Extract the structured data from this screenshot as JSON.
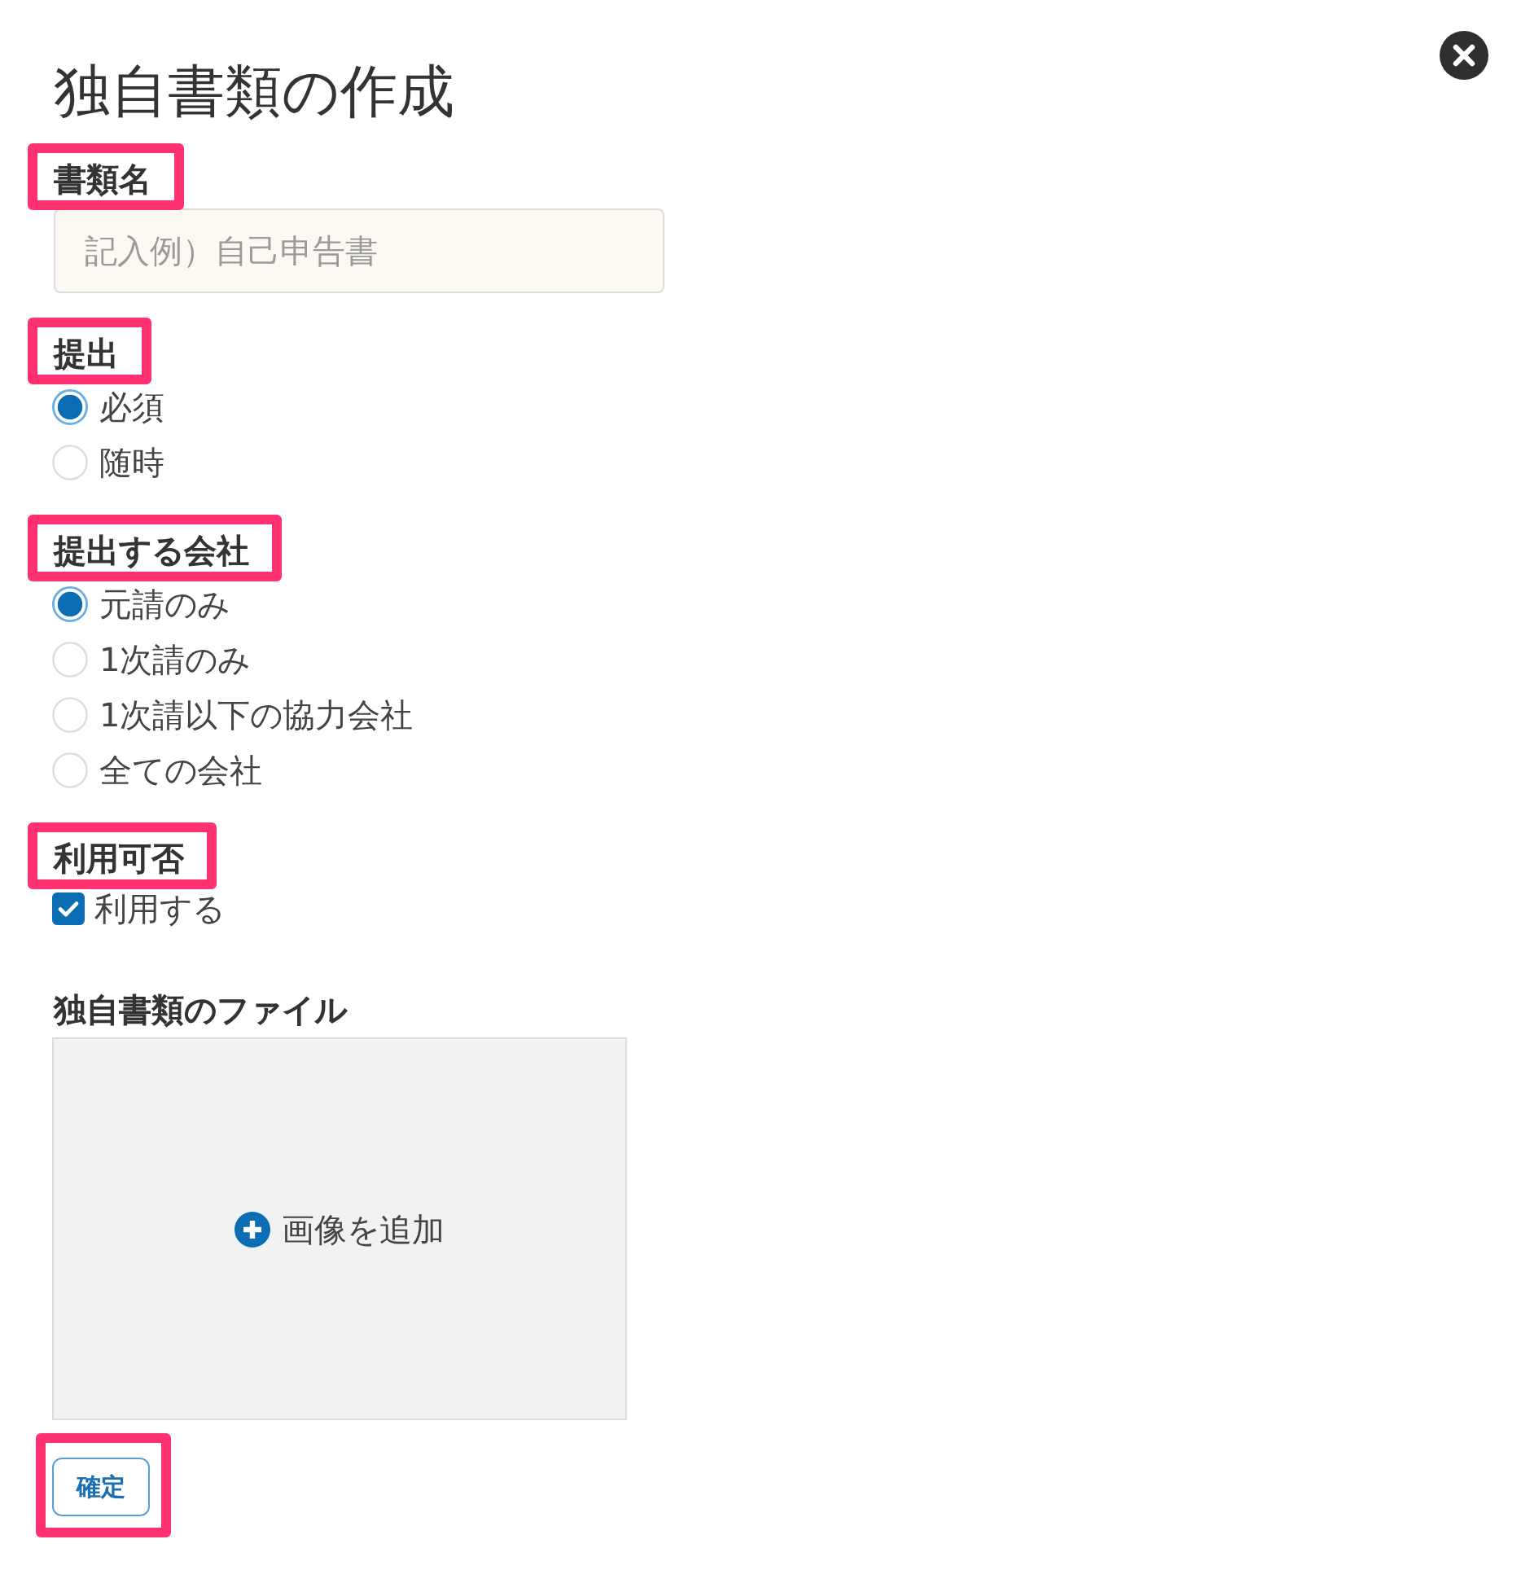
{
  "dialog": {
    "title": "独自書類の作成"
  },
  "fields": [
    {
      "kind": "text",
      "label": "書類名",
      "highlighted": true,
      "placeholder": "記入例）自己申告書"
    },
    {
      "kind": "radio",
      "label": "提出",
      "highlighted": true,
      "options": [
        {
          "label": "必須",
          "selected": true
        },
        {
          "label": "随時",
          "selected": false
        }
      ]
    },
    {
      "kind": "radio",
      "label": "提出する会社",
      "highlighted": true,
      "options": [
        {
          "label": "元請のみ",
          "selected": true
        },
        {
          "label": "1次請のみ",
          "selected": false
        },
        {
          "label": "1次請以下の協力会社",
          "selected": false
        },
        {
          "label": "全ての会社",
          "selected": false
        }
      ]
    },
    {
      "kind": "checkbox",
      "label": "利用可否",
      "highlighted": true,
      "options": [
        {
          "label": "利用する",
          "checked": true
        }
      ]
    },
    {
      "kind": "upload",
      "label": "独自書類のファイル",
      "highlighted": false,
      "action": "画像を追加"
    }
  ],
  "submit": {
    "label": "確定",
    "highlighted": true
  }
}
